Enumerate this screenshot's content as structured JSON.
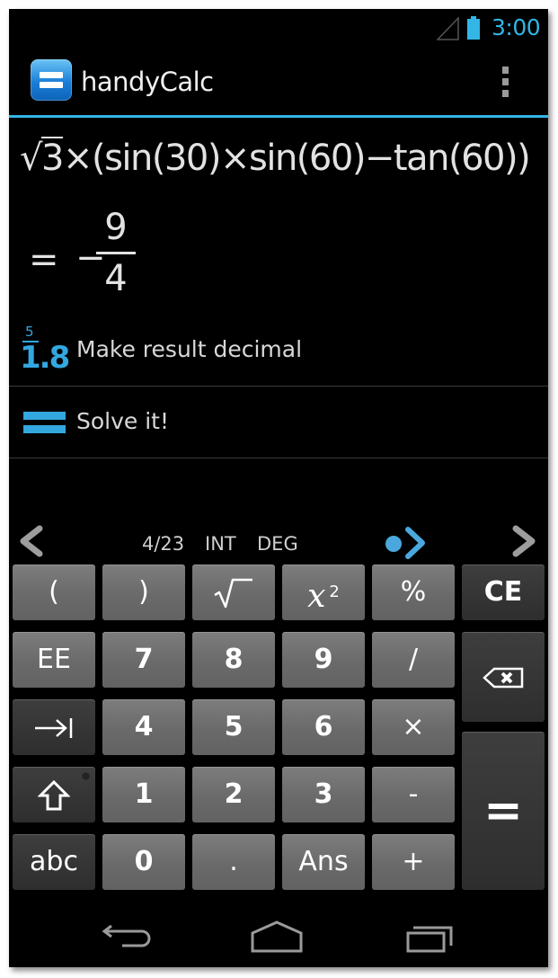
{
  "status_bar": {
    "time": "3:00",
    "signal_icon": "signal-icon",
    "battery_icon": "battery-icon",
    "accent_color": "#33b5e5"
  },
  "action_bar": {
    "app_title": "handyCalc",
    "app_icon": "handycalc-equals-icon",
    "overflow_icon": "overflow-menu-icon"
  },
  "display": {
    "expression": {
      "sqrt_radicand": "3",
      "rest": "×(sin(30)×sin(60)−tan(60))"
    },
    "result": {
      "equals": "=",
      "sign": "−",
      "numerator": "9",
      "denominator": "4"
    }
  },
  "suggestions": [
    {
      "label": "Make result decimal",
      "icon": "fraction-to-decimal-icon",
      "icon_num": "5",
      "icon_den": "1.8("
    },
    {
      "label": "Solve it!",
      "icon": "equals-icon"
    }
  ],
  "keypad_status": {
    "page": "4/23",
    "mode": "INT",
    "angle": "DEG"
  },
  "keys": {
    "row1": [
      "(",
      ")",
      "√",
      "x",
      "%",
      "CE"
    ],
    "x_superscript": "2",
    "row2": [
      "EE",
      "7",
      "8",
      "9",
      "/"
    ],
    "row3": [
      "4",
      "5",
      "6",
      "×"
    ],
    "row4": [
      "1",
      "2",
      "3",
      "-"
    ],
    "row5": [
      "abc",
      "0",
      ".",
      "Ans",
      "+"
    ],
    "equals": "="
  },
  "nav_bar": {
    "back_icon": "back-icon",
    "home_icon": "home-icon",
    "recent_icon": "recent-apps-icon"
  }
}
